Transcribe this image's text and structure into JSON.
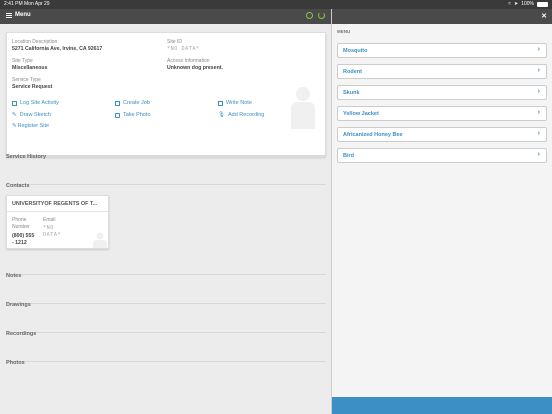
{
  "status_bar": {
    "time": "2:41 PM",
    "date": "Mon Apr 29",
    "battery": "100%"
  },
  "navbar": {
    "menu_label": "Menu"
  },
  "site": {
    "location_description_label": "Location Description",
    "location_description": "5271 California Ave, Irvine, CA 92617",
    "site_id_label": "Site ID",
    "site_id": "*NO DATA*",
    "site_type_label": "Site Type",
    "site_type": "Miscellaneous",
    "access_info_label": "Access Information",
    "access_info": "Unknown dog present.",
    "service_type_label": "Service Type",
    "service_type": "Service Request"
  },
  "actions": {
    "log_site_activity": "Log Site Activity",
    "create_job": "Create Job",
    "write_note": "Write Note",
    "draw_sketch": "Draw Sketch",
    "take_photo": "Take Photo",
    "add_recording": "Add Recording",
    "register_site": "Register Site"
  },
  "sections": {
    "service_history": "Service History",
    "contacts": "Contacts",
    "notes": "Notes",
    "drawings": "Drawings",
    "recordings": "Recordings",
    "photos": "Photos"
  },
  "contact": {
    "name": "UNIVERSITYOF REGENTS OF T...",
    "phone_label_1": "Phone",
    "phone_label_2": "Number",
    "phone_1": "(800) 555",
    "phone_2": "- 1212",
    "email_label": "Email",
    "email_1": "*NO",
    "email_2": "DATA*"
  },
  "side_menu": {
    "header": "MENU",
    "items": [
      {
        "label": "Mosquito"
      },
      {
        "label": "Rodent"
      },
      {
        "label": "Skunk"
      },
      {
        "label": "Yellow Jacket"
      },
      {
        "label": "Africanized Honey Bee"
      },
      {
        "label": "Bird"
      }
    ]
  },
  "colors": {
    "accent": "#3b8fc4",
    "navbar": "#4a4a4a",
    "sync_icon": "#8bc34a"
  }
}
